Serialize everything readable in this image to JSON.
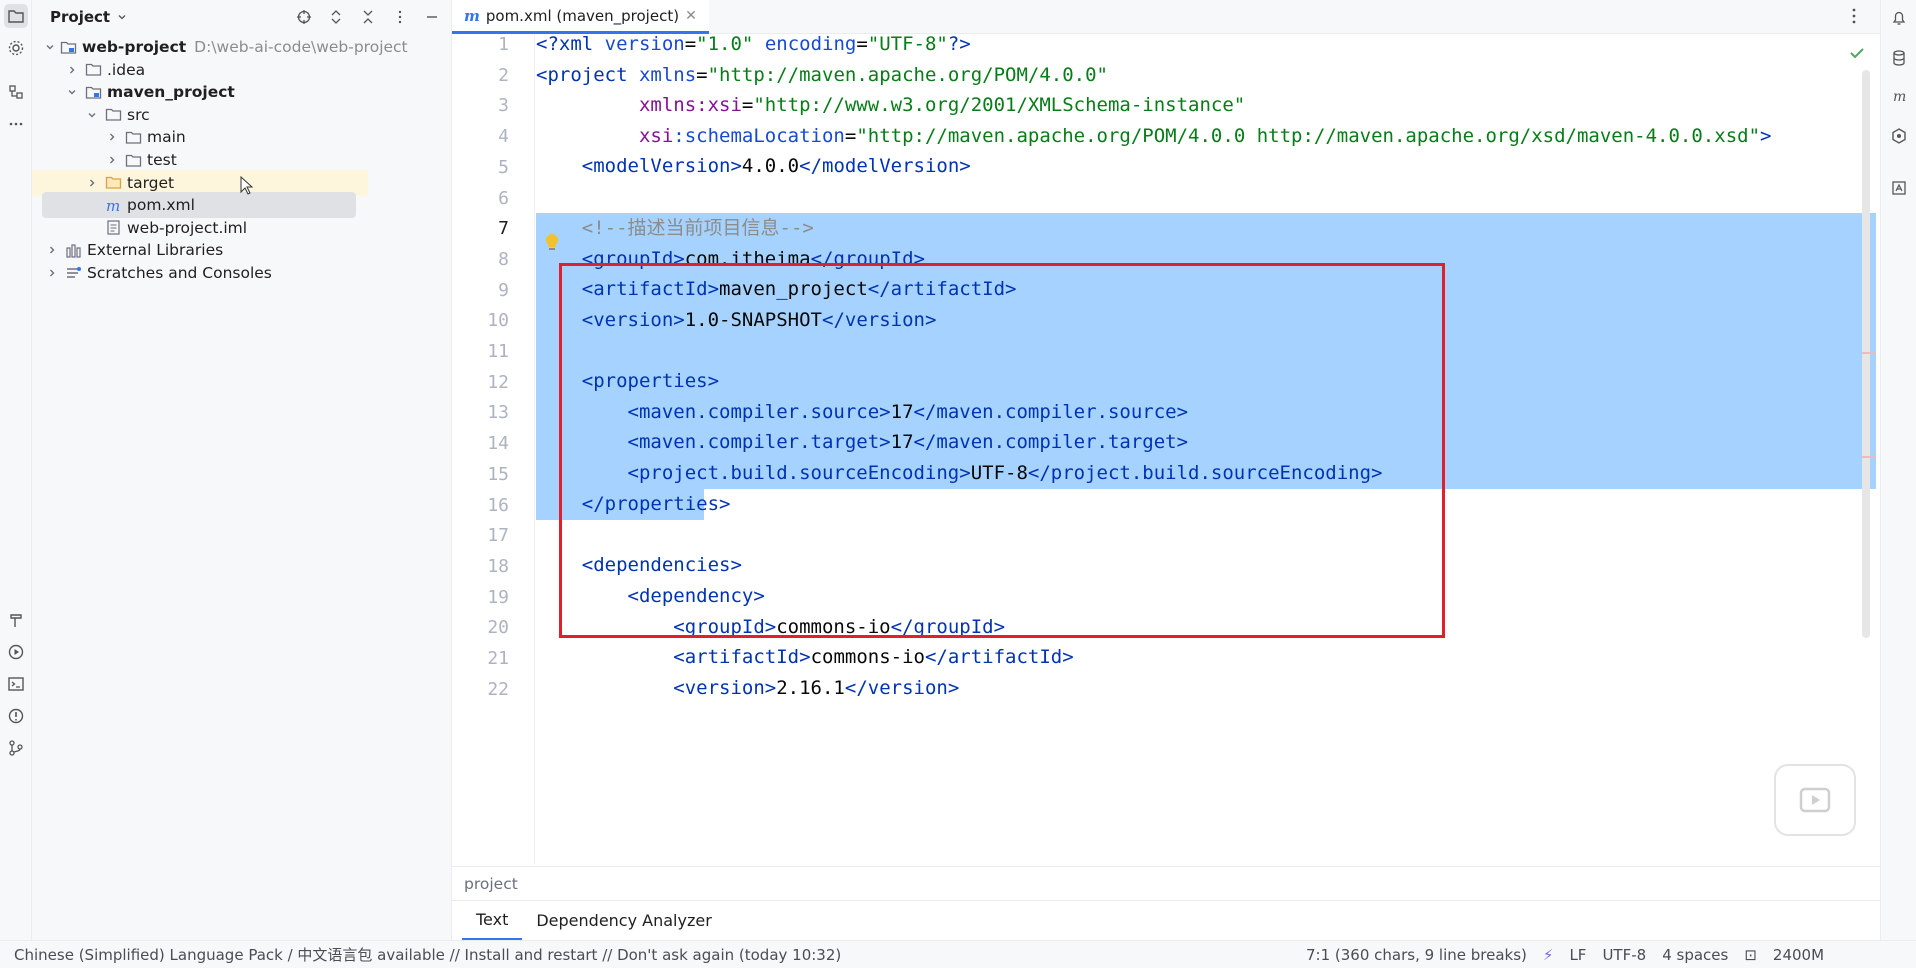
{
  "project_panel": {
    "title": "Project",
    "tree": [
      {
        "label": "web-project",
        "hint": "D:\\web-ai-code\\web-project",
        "level": 0,
        "expanded": true,
        "icon": "module-folder-icon",
        "bold": true
      },
      {
        "label": ".idea",
        "level": 1,
        "expanded": false,
        "icon": "folder-icon"
      },
      {
        "label": "maven_project",
        "level": 1,
        "expanded": true,
        "icon": "module-folder-icon",
        "bold": true
      },
      {
        "label": "src",
        "level": 2,
        "expanded": true,
        "icon": "folder-icon"
      },
      {
        "label": "main",
        "level": 3,
        "expanded": false,
        "icon": "folder-icon"
      },
      {
        "label": "test",
        "level": 3,
        "expanded": false,
        "icon": "folder-icon"
      },
      {
        "label": "target",
        "level": 2,
        "expanded": false,
        "icon": "excluded-folder-icon"
      },
      {
        "label": "pom.xml",
        "level": 2,
        "icon": "maven-file-icon",
        "selected": true
      },
      {
        "label": "web-project.iml",
        "level": 2,
        "icon": "iml-file-icon"
      },
      {
        "label": "External Libraries",
        "level": 0,
        "expanded": false,
        "icon": "library-icon"
      },
      {
        "label": "Scratches and Consoles",
        "level": 0,
        "expanded": false,
        "icon": "scratches-icon"
      }
    ]
  },
  "editor": {
    "tab_label": "pom.xml (maven_project)",
    "tab_icon_letter": "m",
    "current_line": "7",
    "line_numbers": [
      "1",
      "2",
      "3",
      "4",
      "5",
      "6",
      "7",
      "8",
      "9",
      "10",
      "11",
      "12",
      "13",
      "14",
      "15",
      "16",
      "17",
      "18",
      "19",
      "20",
      "21",
      "22"
    ]
  },
  "breadcrumb": "project",
  "bottom_tabs": [
    "Text",
    "Dependency Analyzer"
  ],
  "status": {
    "notification": "Chinese (Simplified) Language Pack / 中文语言包 available // Install and restart // Don't ask again (today 10:32)",
    "position": "7:1 (360 chars, 9 line breaks)",
    "line_ending": "LF",
    "encoding": "UTF-8",
    "indent": "4 spaces",
    "memory": "2400M"
  },
  "colors": {
    "accent": "#3574f0",
    "selection": "#a6d2ff",
    "highlight_box": "#e0202c"
  }
}
